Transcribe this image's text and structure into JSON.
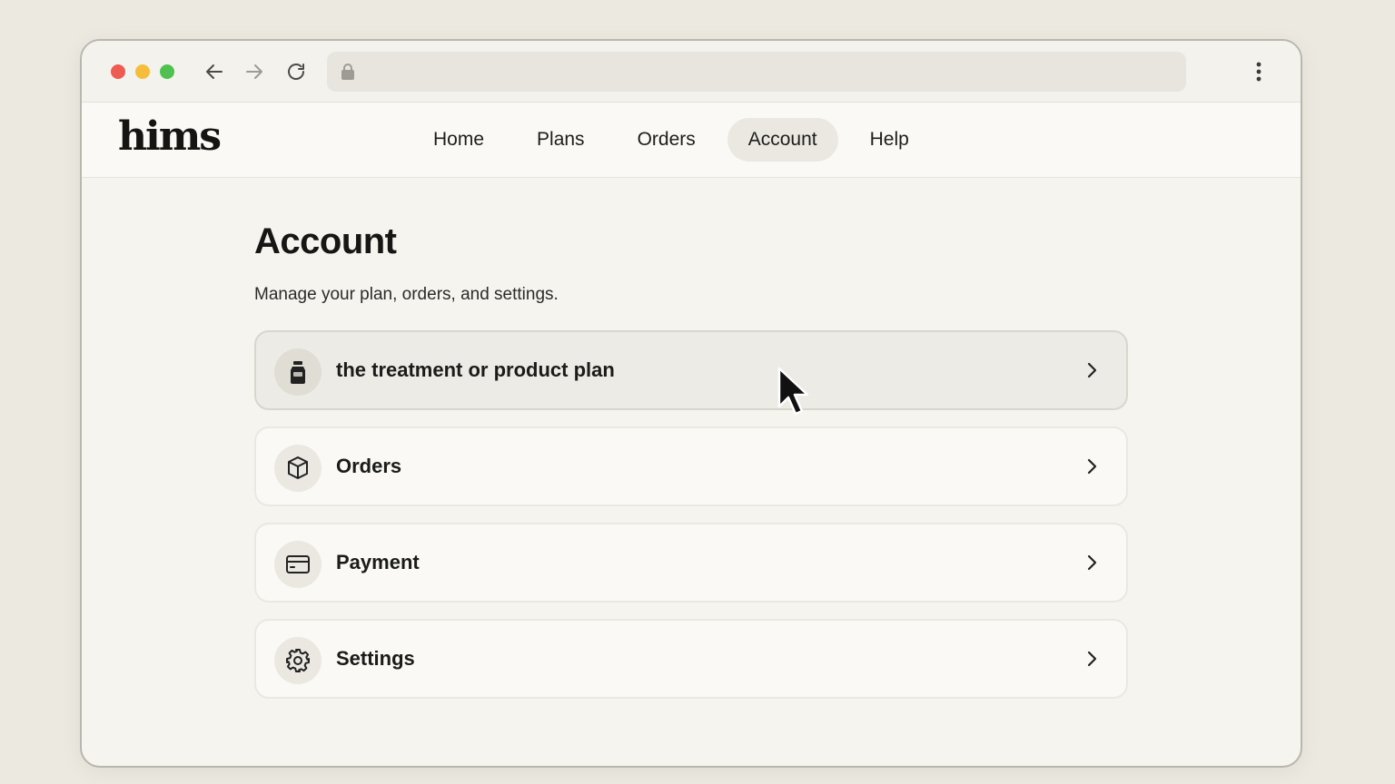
{
  "browser": {
    "address_bar": ""
  },
  "header": {
    "logo": "hims",
    "nav": [
      {
        "label": "Home",
        "active": false
      },
      {
        "label": "Plans",
        "active": false
      },
      {
        "label": "Orders",
        "active": false
      },
      {
        "label": "Account",
        "active": true
      },
      {
        "label": "Help",
        "active": false
      }
    ]
  },
  "main": {
    "title": "Account",
    "subtitle": "Manage your plan, orders, and settings.",
    "cards": [
      {
        "label": "the treatment or product plan",
        "icon": "bottle-icon",
        "hovered": true
      },
      {
        "label": "Orders",
        "icon": "box-icon",
        "hovered": false
      },
      {
        "label": "Payment",
        "icon": "card-icon",
        "hovered": false
      },
      {
        "label": "Settings",
        "icon": "gear-icon",
        "hovered": false
      }
    ]
  },
  "colors": {
    "background": "#ece9e1",
    "active_nav": "#ebe8e1",
    "text": "#1d1d1b",
    "close": "#ee5b53",
    "minimize": "#f5bd3a",
    "maximize": "#4fc14f"
  }
}
